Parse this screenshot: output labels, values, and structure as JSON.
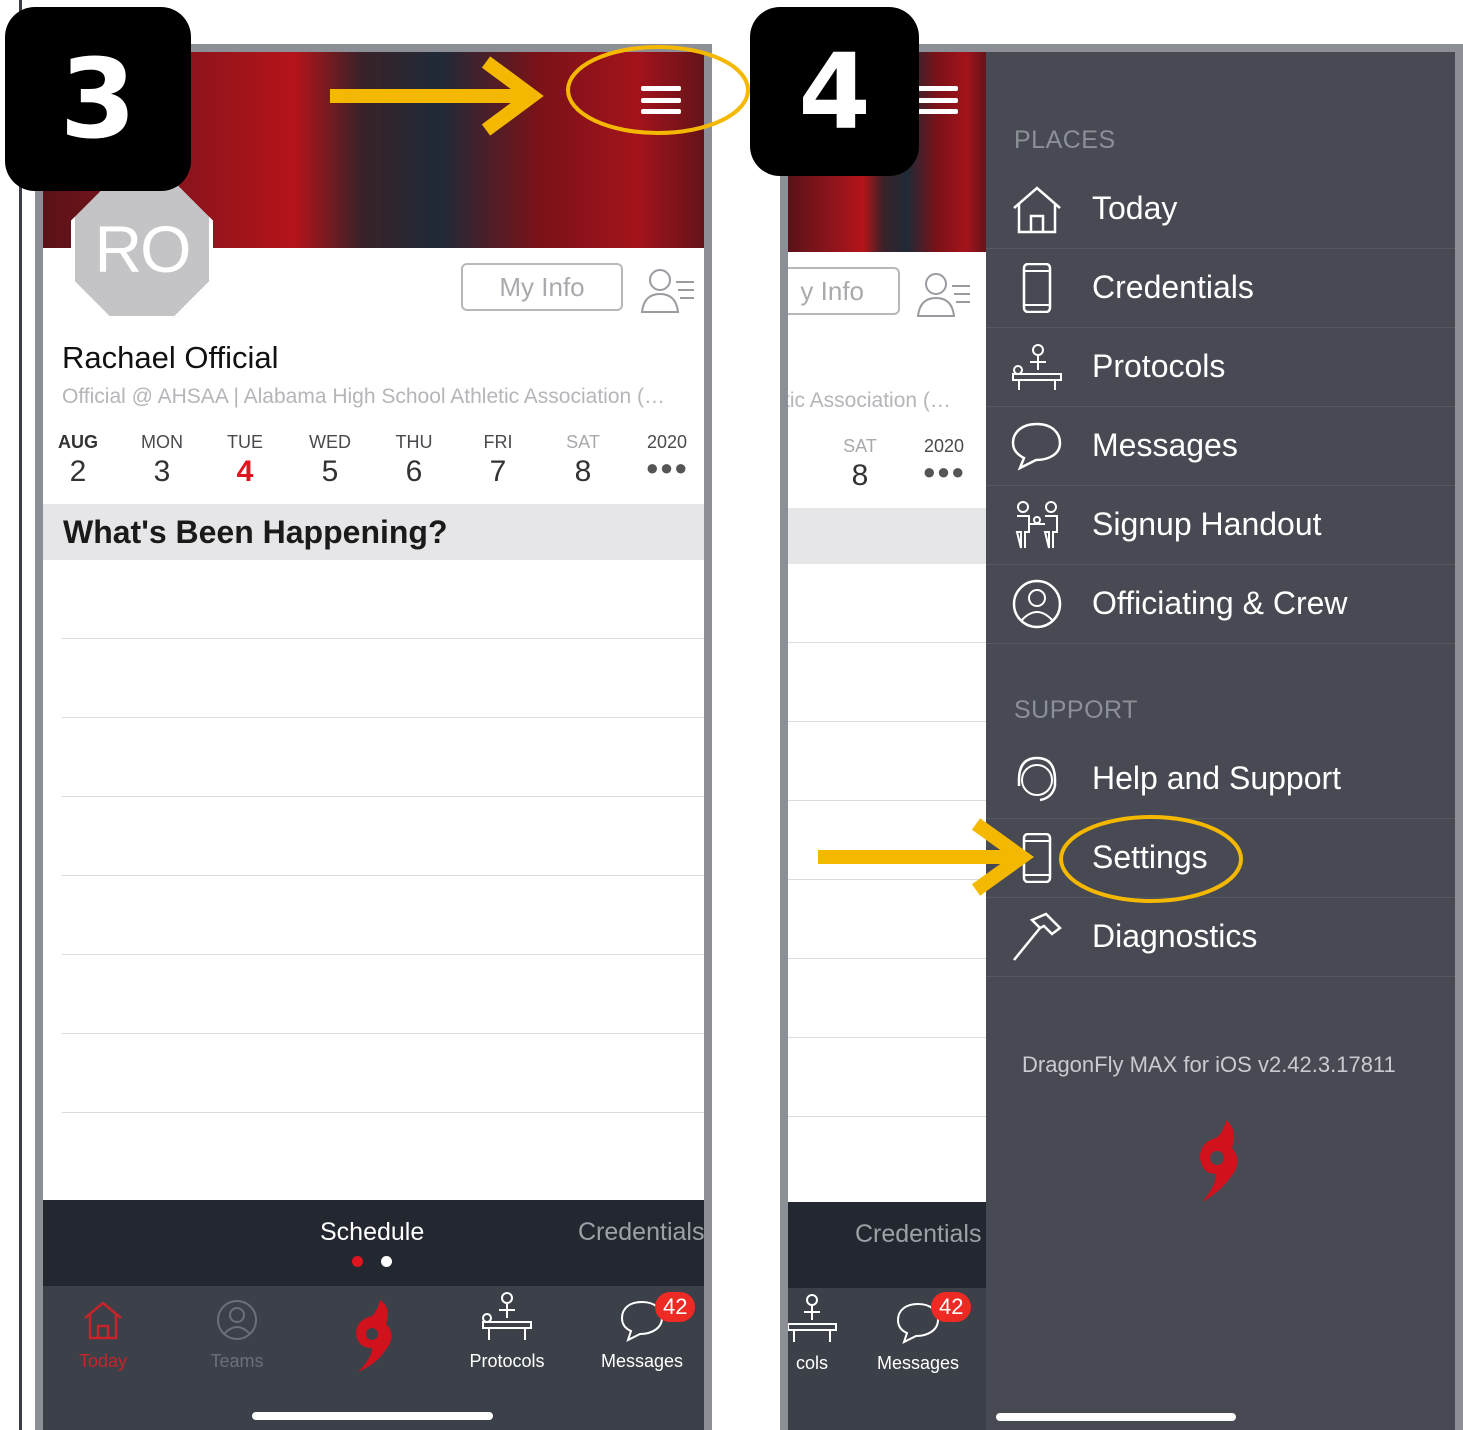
{
  "steps": {
    "first": "3",
    "second": "4"
  },
  "profile": {
    "initials": "RO",
    "name": "Rachael Official",
    "subtitle": "Official @ AHSAA | Alabama High School Athletic Association (…",
    "subtitle_cut": "tic Association (…",
    "my_info_label": "My Info",
    "my_info_label_cut": "y Info"
  },
  "calendar": {
    "days": [
      {
        "name": "AUG",
        "date": "2"
      },
      {
        "name": "MON",
        "date": "3"
      },
      {
        "name": "TUE",
        "date": "4"
      },
      {
        "name": "WED",
        "date": "5"
      },
      {
        "name": "THU",
        "date": "6"
      },
      {
        "name": "FRI",
        "date": "7"
      },
      {
        "name": "SAT",
        "date": "8"
      }
    ],
    "year": "2020",
    "more": "●●●"
  },
  "feed": {
    "title": "What's Been Happening?"
  },
  "tabstrip": {
    "schedule": "Schedule",
    "credentials": "Credentials"
  },
  "navbar": {
    "today": "Today",
    "teams": "Teams",
    "protocols": "Protocols",
    "protocols_cut": "cols",
    "messages": "Messages",
    "messages_badge": "42"
  },
  "drawer": {
    "places_header": "PLACES",
    "support_header": "SUPPORT",
    "places": [
      "Today",
      "Credentials",
      "Protocols",
      "Messages",
      "Signup Handout",
      "Officiating & Crew"
    ],
    "support": [
      "Help and Support",
      "Settings",
      "Diagnostics"
    ],
    "version": "DragonFly MAX for iOS v2.42.3.17811"
  },
  "colors": {
    "accent_red": "#e0141e",
    "annotation_yellow": "#f5b800",
    "drawer_bg": "#474a52",
    "tab_bg": "#23272f",
    "nav_bg": "#3c4048"
  },
  "icons": {
    "menu": "hamburger-icon",
    "home": "home-icon",
    "phone": "phone-icon",
    "massage": "massage-table-icon",
    "chat": "speech-bubble-icon",
    "family": "family-icon",
    "person": "person-circle-icon",
    "headset": "headset-icon",
    "hammer": "hammer-icon",
    "logo": "dragonfly-logo-icon"
  }
}
